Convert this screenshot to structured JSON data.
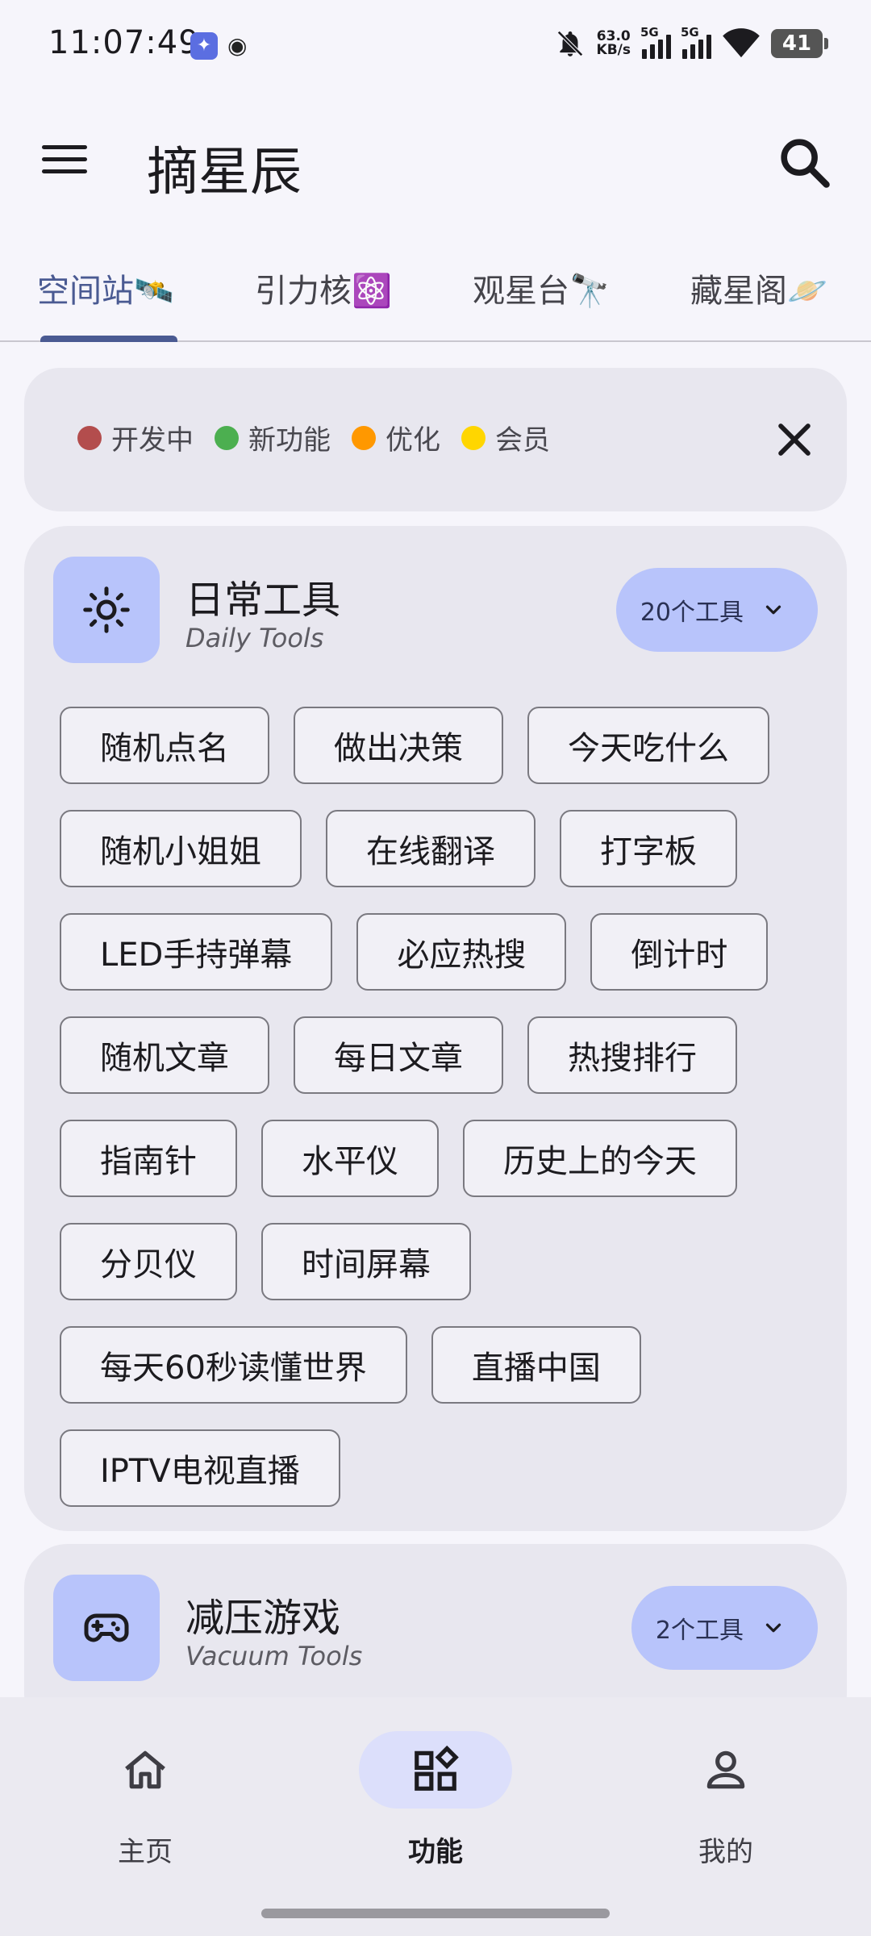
{
  "status_bar": {
    "time": "11:07:49",
    "net_speed_value": "63.0",
    "net_speed_unit": "KB/s",
    "sim1": "5G",
    "sim2": "5G",
    "battery": "41"
  },
  "app_bar": {
    "title": "摘星辰"
  },
  "tabs": [
    {
      "label": "空间站🛰️",
      "active": true
    },
    {
      "label": "引力核⚛️",
      "active": false
    },
    {
      "label": "观星台🔭",
      "active": false
    },
    {
      "label": "藏星阁🪐",
      "active": false
    }
  ],
  "legend": {
    "items": [
      {
        "label": "开发中",
        "color": "#b34d4d"
      },
      {
        "label": "新功能",
        "color": "#4caf50"
      },
      {
        "label": "优化",
        "color": "#ff9800"
      },
      {
        "label": "会员",
        "color": "#ffd600"
      }
    ]
  },
  "categories": [
    {
      "title": "日常工具",
      "subtitle": "Daily Tools",
      "count_label": "20个工具",
      "icon": "sun-icon",
      "tools": [
        "随机点名",
        "做出决策",
        "今天吃什么",
        "随机小姐姐",
        "在线翻译",
        "打字板",
        "LED手持弹幕",
        "必应热搜",
        "倒计时",
        "随机文章",
        "每日文章",
        "热搜排行",
        "指南针",
        "水平仪",
        "历史上的今天",
        "分贝仪",
        "时间屏幕",
        "每天60秒读懂世界",
        "直播中国",
        "IPTV电视直播"
      ]
    },
    {
      "title": "减压游戏",
      "subtitle": "Vacuum Tools",
      "count_label": "2个工具",
      "icon": "gamepad-icon"
    }
  ],
  "bottom_nav": [
    {
      "label": "主页",
      "icon": "home-icon",
      "active": false
    },
    {
      "label": "功能",
      "icon": "widgets-icon",
      "active": true
    },
    {
      "label": "我的",
      "icon": "person-icon",
      "active": false
    }
  ],
  "colors": {
    "accent": "#4a5a92",
    "chip_icon_bg": "#b8c4fb",
    "card_bg": "#e8e7ef"
  }
}
